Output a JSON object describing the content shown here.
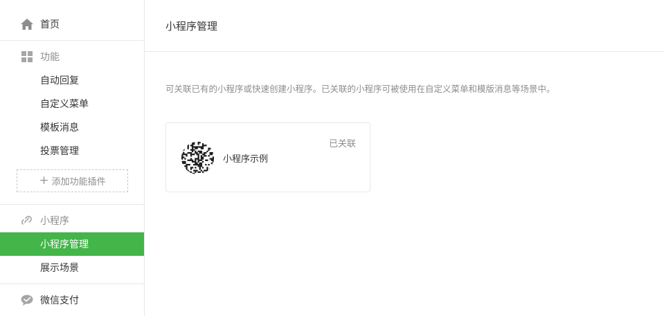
{
  "sidebar": {
    "home": {
      "label": "首页",
      "icon": "home-icon"
    },
    "functions": {
      "label": "功能",
      "icon": "grid-icon",
      "items": [
        {
          "label": "自动回复"
        },
        {
          "label": "自定义菜单"
        },
        {
          "label": "模板消息"
        },
        {
          "label": "投票管理"
        }
      ],
      "add_plugin_label": "添加功能插件"
    },
    "miniprogram": {
      "label": "小程序",
      "icon": "link-icon",
      "items": [
        {
          "label": "小程序管理",
          "active": true
        },
        {
          "label": "展示场景"
        }
      ]
    },
    "wechat_pay": {
      "label": "微信支付",
      "icon": "wechat-pay-icon"
    }
  },
  "main": {
    "title": "小程序管理",
    "description": "可关联已有的小程序或快速创建小程序。已关联的小程序可被使用在自定义菜单和模版消息等场景中。",
    "card": {
      "status": "已关联",
      "name": "小程序示例",
      "icon": "qr-code-icon"
    }
  },
  "colors": {
    "accent": "#44b549",
    "border": "#e7e7eb",
    "muted_text": "#8d8d8d",
    "text": "#353535"
  }
}
